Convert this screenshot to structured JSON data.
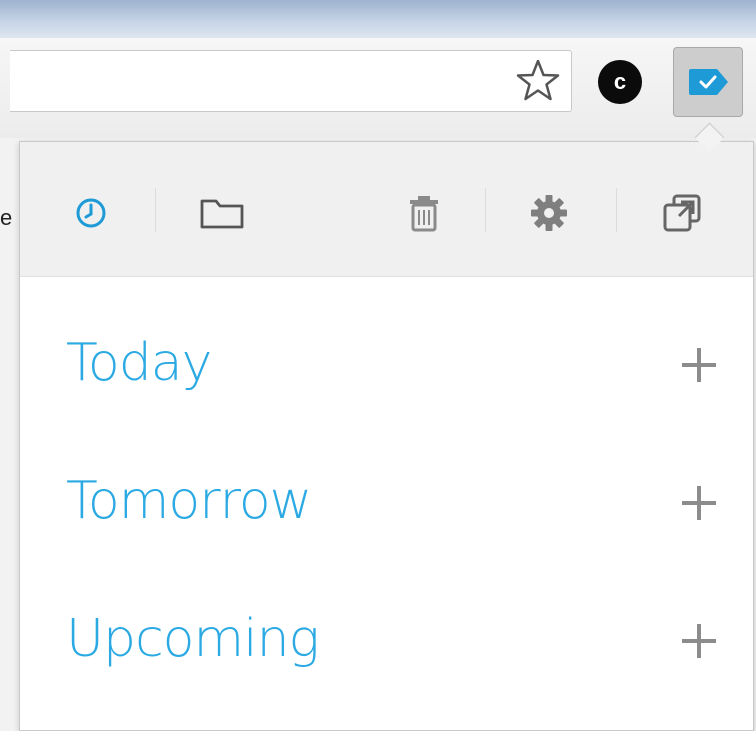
{
  "browser": {
    "extensions": [
      {
        "name": "c-extension",
        "label": "c"
      },
      {
        "name": "todo-extension",
        "label": ""
      }
    ],
    "page_fragment": "e"
  },
  "popup": {
    "toolbar": {
      "icons": [
        "clock-icon",
        "folder-icon",
        "trash-icon",
        "gear-icon",
        "popout-icon"
      ]
    },
    "sections": [
      {
        "id": "today",
        "label": "Today"
      },
      {
        "id": "tomorrow",
        "label": "Tomorrow"
      },
      {
        "id": "upcoming",
        "label": "Upcoming"
      }
    ]
  },
  "colors": {
    "accent": "#2aa9e3",
    "icon_gray": "#8c8c8c"
  }
}
